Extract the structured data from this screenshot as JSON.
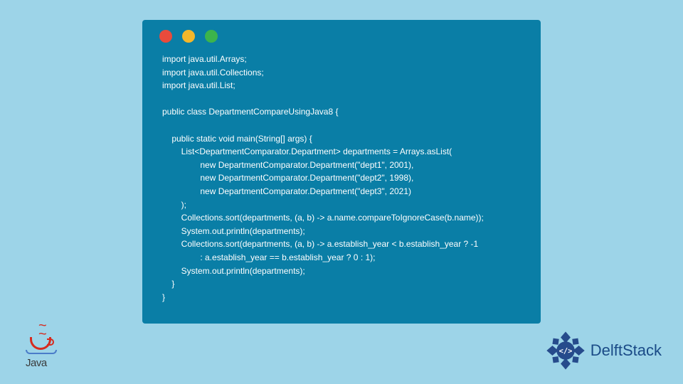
{
  "code": {
    "lines": [
      "import java.util.Arrays;",
      "import java.util.Collections;",
      "import java.util.List;",
      "",
      "public class DepartmentCompareUsingJava8 {",
      "",
      "    public static void main(String[] args) {",
      "        List<DepartmentComparator.Department> departments = Arrays.asList(",
      "                new DepartmentComparator.Department(\"dept1\", 2001),",
      "                new DepartmentComparator.Department(\"dept2\", 1998),",
      "                new DepartmentComparator.Department(\"dept3\", 2021)",
      "        );",
      "        Collections.sort(departments, (a, b) -> a.name.compareToIgnoreCase(b.name));",
      "        System.out.println(departments);",
      "        Collections.sort(departments, (a, b) -> a.establish_year < b.establish_year ? -1",
      "                : a.establish_year == b.establish_year ? 0 : 1);",
      "        System.out.println(departments);",
      "    }",
      "}"
    ]
  },
  "logos": {
    "java_label": "Java",
    "delft_label": "DelftStack"
  },
  "colors": {
    "bg": "#9dd4e8",
    "window": "#0a7ea6",
    "red": "#e94b3c",
    "yellow": "#f5b72a",
    "green": "#3cb44c",
    "delft_blue": "#1a4b87"
  }
}
